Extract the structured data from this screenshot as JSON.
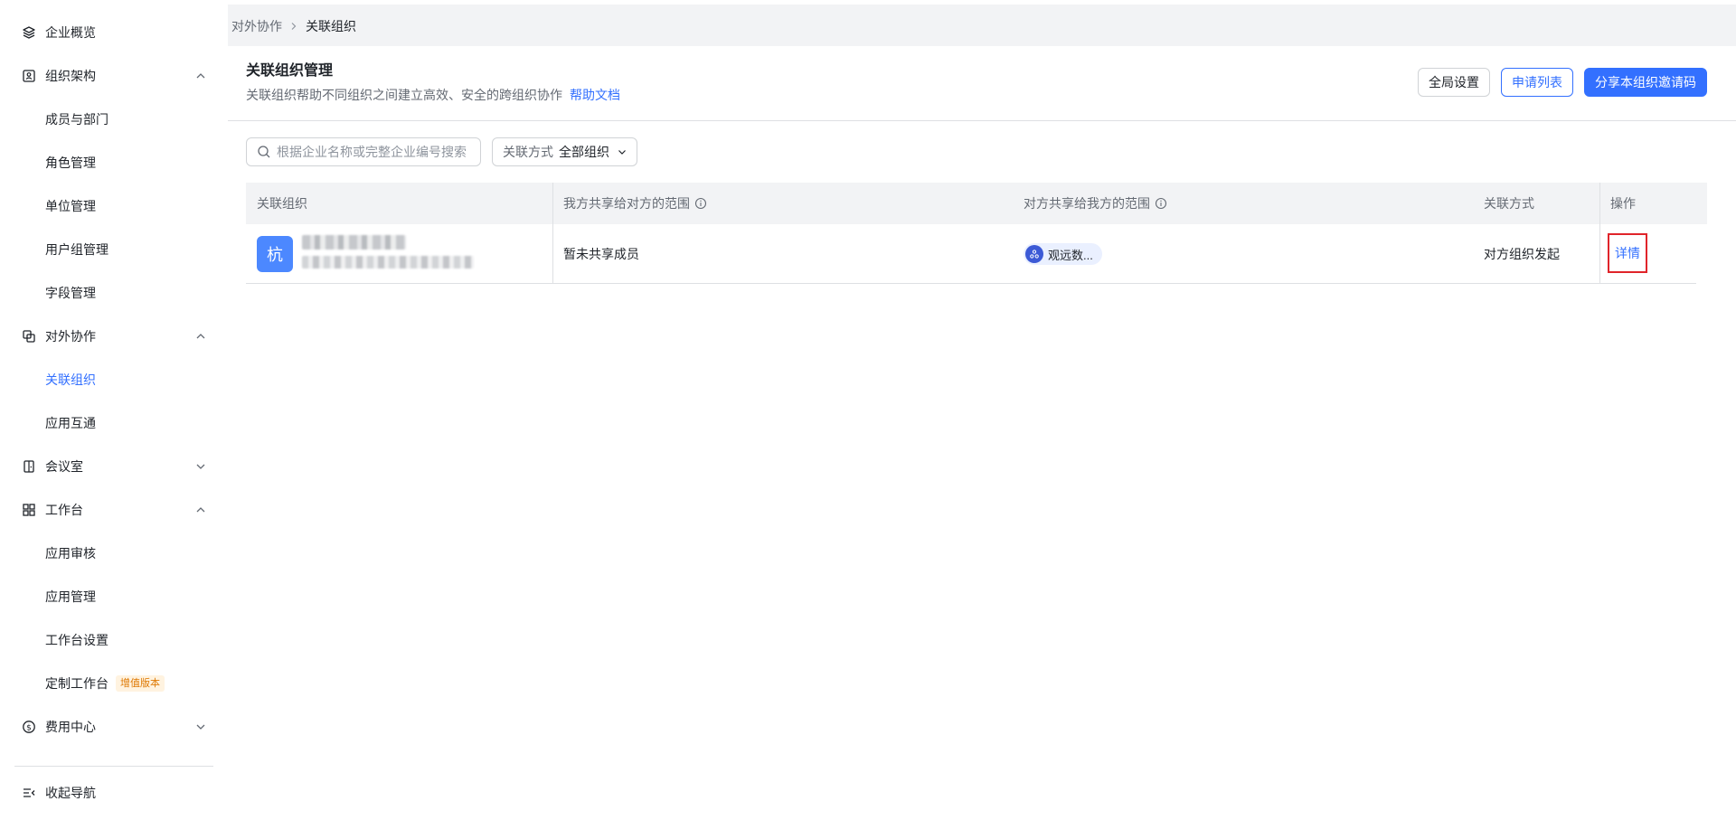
{
  "sidebar": {
    "items": [
      {
        "label": "企业概览",
        "icon": "layers-icon"
      },
      {
        "label": "组织架构",
        "icon": "org-chart-icon",
        "expanded": true
      },
      {
        "label": "成员与部门"
      },
      {
        "label": "角色管理"
      },
      {
        "label": "单位管理"
      },
      {
        "label": "用户组管理"
      },
      {
        "label": "字段管理"
      },
      {
        "label": "对外协作",
        "icon": "collaboration-icon",
        "expanded": true
      },
      {
        "label": "关联组织",
        "active": true
      },
      {
        "label": "应用互通"
      },
      {
        "label": "会议室",
        "icon": "meeting-room-icon",
        "expanded": false
      },
      {
        "label": "工作台",
        "icon": "grid-icon",
        "expanded": true
      },
      {
        "label": "应用审核"
      },
      {
        "label": "应用管理"
      },
      {
        "label": "工作台设置"
      },
      {
        "label": "定制工作台",
        "badge": "增值版本"
      },
      {
        "label": "费用中心",
        "icon": "dollar-icon",
        "expanded": false
      }
    ],
    "collapse_label": "收起导航"
  },
  "breadcrumb": {
    "parent": "对外协作",
    "current": "关联组织"
  },
  "page": {
    "title": "关联组织管理",
    "description": "关联组织帮助不同组织之间建立高效、安全的跨组织协作",
    "help_link": "帮助文档",
    "buttons": {
      "global_settings": "全局设置",
      "application_list": "申请列表",
      "share_invite": "分享本组织邀请码"
    }
  },
  "filters": {
    "search_placeholder": "根据企业名称或完整企业编号搜索",
    "relation_key": "关联方式",
    "relation_value": "全部组织"
  },
  "table": {
    "columns": [
      "关联组织",
      "我方共享给对方的范围",
      "对方共享给我方的范围",
      "关联方式",
      "操作"
    ],
    "rows": [
      {
        "org_avatar_text": "杭",
        "our_share_scope": "暂未共享成员",
        "their_share_scope": "观远数...",
        "relation_type": "对方组织发起",
        "action": "详情"
      }
    ]
  },
  "colors": {
    "accent": "#3370ff",
    "avatar": "#4c88ff",
    "highlight_box": "#e0242a",
    "badge_text": "#de7802"
  }
}
